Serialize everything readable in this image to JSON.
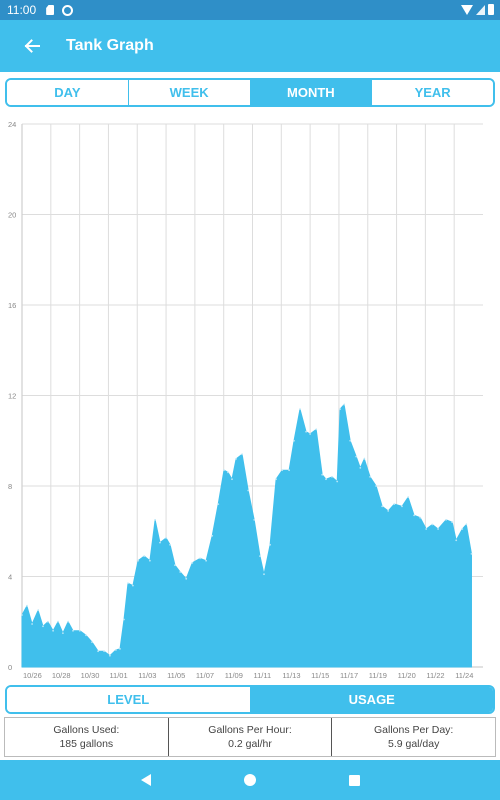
{
  "status_bar": {
    "time": "11:00",
    "icons": [
      "sd-card-icon",
      "sync-icon",
      "wifi-icon",
      "signal-icon",
      "battery-icon"
    ]
  },
  "app_bar": {
    "back_icon": "arrow-left-icon",
    "title": "Tank Graph"
  },
  "range_tabs": {
    "options": [
      "DAY",
      "WEEK",
      "MONTH",
      "YEAR"
    ],
    "selected": "MONTH"
  },
  "mode_tabs": {
    "options": [
      "LEVEL",
      "USAGE"
    ],
    "selected": "USAGE"
  },
  "stats": [
    {
      "label": "Gallons Used:",
      "value": "185 gallons"
    },
    {
      "label": "Gallons Per Hour:",
      "value": "0.2 gal/hr"
    },
    {
      "label": "Gallons Per Day:",
      "value": "5.9 gal/day"
    }
  ],
  "nav_bar": {
    "icons": [
      "back-triangle-icon",
      "home-circle-icon",
      "recents-square-icon"
    ]
  },
  "colors": {
    "primary": "#40bfec",
    "status_bar": "#2f8fc8",
    "grid": "#dddddd"
  },
  "chart_data": {
    "type": "area",
    "title": "",
    "xlabel": "",
    "ylabel": "",
    "ylim": [
      0,
      24
    ],
    "yticks": [
      0,
      4,
      8,
      12,
      16,
      20,
      24
    ],
    "ytick_labels": [
      "0",
      "4",
      "8",
      "12",
      "16",
      "20",
      "24"
    ],
    "xlim_days": [
      0,
      16
    ],
    "xtick_labels": [
      "10/26",
      "10/28",
      "10/30",
      "11/01",
      "11/03",
      "11/05",
      "11/07",
      "11/09",
      "11/11",
      "11/13",
      "11/15",
      "11/17",
      "11/19",
      "11/20",
      "11/22",
      "11/24"
    ],
    "grid": true,
    "legend": "none",
    "series": [
      {
        "name": "Usage",
        "color": "#40bfec",
        "x": [
          0,
          0.17,
          0.35,
          0.56,
          0.73,
          0.9,
          1.08,
          1.25,
          1.42,
          1.6,
          1.77,
          2.01,
          2.22,
          2.43,
          2.64,
          2.85,
          3.05,
          3.26,
          3.4,
          3.54,
          3.68,
          3.85,
          4.03,
          4.24,
          4.44,
          4.62,
          4.79,
          5.0,
          5.14,
          5.31,
          5.49,
          5.7,
          5.91,
          6.18,
          6.39,
          6.6,
          6.81,
          7.01,
          7.15,
          7.29,
          7.43,
          7.64,
          7.85,
          8.06,
          8.26,
          8.4,
          8.61,
          8.82,
          9.03,
          9.27,
          9.44,
          9.65,
          9.86,
          10.0,
          10.21,
          10.42,
          10.55,
          10.76,
          10.94,
          11.04,
          11.18,
          11.39,
          11.6,
          11.74,
          11.88,
          12.08,
          12.29,
          12.5,
          12.71,
          12.92,
          13.19,
          13.4,
          13.61,
          13.82,
          14.03,
          14.24,
          14.44,
          14.72,
          14.93,
          15.07,
          15.28,
          15.42,
          15.6
        ],
        "values": [
          2.3,
          2.7,
          1.9,
          2.5,
          1.8,
          2.0,
          1.6,
          2.0,
          1.5,
          2.0,
          1.6,
          1.6,
          1.4,
          1.1,
          0.7,
          0.7,
          0.5,
          0.75,
          0.8,
          2.1,
          3.7,
          3.6,
          4.7,
          4.9,
          4.7,
          6.5,
          5.5,
          5.7,
          5.4,
          4.5,
          4.2,
          3.9,
          4.6,
          4.8,
          4.7,
          5.8,
          7.2,
          8.7,
          8.6,
          8.3,
          9.2,
          9.4,
          7.8,
          6.5,
          4.9,
          4.1,
          5.4,
          8.3,
          8.7,
          8.7,
          10.0,
          11.4,
          10.4,
          10.3,
          10.5,
          8.5,
          8.3,
          8.4,
          8.2,
          11.4,
          11.6,
          10.0,
          9.3,
          8.8,
          9.2,
          8.4,
          8.0,
          7.1,
          6.9,
          7.2,
          7.1,
          7.5,
          6.7,
          6.6,
          6.1,
          6.3,
          6.1,
          6.5,
          6.4,
          5.6,
          6.1,
          6.3,
          5.0,
          6.4
        ]
      }
    ]
  }
}
